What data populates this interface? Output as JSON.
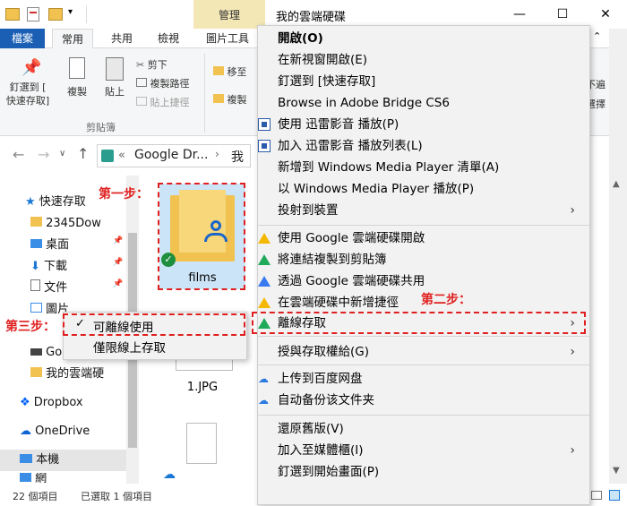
{
  "window": {
    "manage_tab": "管理",
    "title": "我的雲端硬碟",
    "minimize": "—",
    "maximize": "☐",
    "close": "✕"
  },
  "ribbon_tabs": [
    "檔案",
    "常用",
    "共用",
    "檢視",
    "圖片工具"
  ],
  "ribbon": {
    "pin_label": "釘選到 [\n快速存取]",
    "copy_label": "複製",
    "paste_label": "貼上",
    "cut": "剪下",
    "copy_path": "複製路徑",
    "paste_shortcut": "貼上捷徑",
    "group_clipboard": "剪貼簿",
    "move_to": "移至",
    "copy_to": "複製",
    "right_text1": "不遍",
    "right_text2": "選擇"
  },
  "address": {
    "crumb1": "Google Dr...",
    "crumb2": "我"
  },
  "nav": {
    "items": [
      "快速存取",
      "2345Dow",
      "桌面",
      "下載",
      "文件",
      "圖片",
      "Go",
      "我的雲端硬",
      "Dropbox",
      "OneDrive",
      "本機",
      "網"
    ]
  },
  "content": {
    "folder_name": "films",
    "file2_name": "1.JPG"
  },
  "status": {
    "count": "22 個項目",
    "selected": "已選取 1 個項目"
  },
  "context_menu": {
    "items": [
      "開啟(O)",
      "在新視窗開啟(E)",
      "釘選到 [快速存取]",
      "Browse in Adobe Bridge CS6",
      "使用 迅雷影音 播放(P)",
      "加入 迅雷影音 播放列表(L)",
      "新增到 Windows Media Player 清單(A)",
      "以 Windows Media Player 播放(P)",
      "投射到裝置",
      "使用 Google 雲端硬碟開啟",
      "將連結複製到剪貼簿",
      "透過 Google 雲端硬碟共用",
      "在雲端硬碟中新增捷徑",
      "離線存取",
      "授與存取權給(G)",
      "上传到百度网盘",
      "自动备份该文件夹",
      "還原舊版(V)",
      "加入至媒體櫃(I)",
      "釘選到開始畫面(P)"
    ]
  },
  "submenu": {
    "item1": "可離線使用",
    "item2": "僅限線上存取",
    "check": "✓"
  },
  "annotations": {
    "step1": "第一步：",
    "step2": "第二步：",
    "step3": "第三步："
  },
  "colors": {
    "accent": "#1a5fb4",
    "annotation": "#e02020",
    "folder": "#f2c250",
    "selection": "#cce4f7"
  }
}
